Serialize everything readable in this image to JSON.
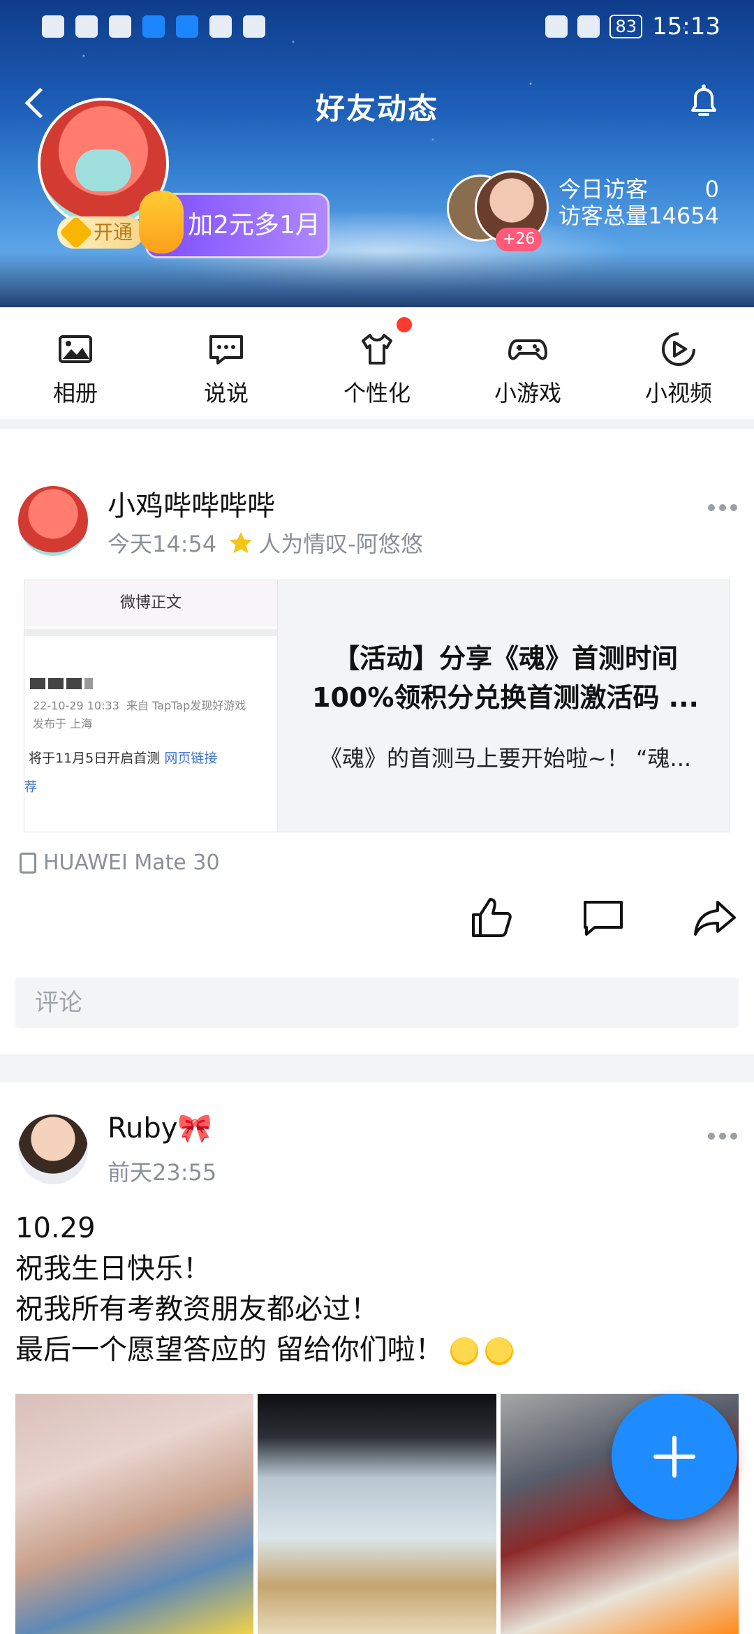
{
  "status_bar": {
    "left_icons": [
      "hd-icon",
      "signal-5g-icon",
      "wifi-icon",
      "shield-icon",
      "bulb-icon",
      "wechat-icon",
      "glove-icon"
    ],
    "battery": "83",
    "time": "15:13"
  },
  "header": {
    "title": "好友动态",
    "vip_label": "开通",
    "promo_text": "加2元多1月",
    "visitor_badge": "+26",
    "today_visitors_label": "今日访客",
    "today_visitors_value": "0",
    "total_visitors_label": "访客总量",
    "total_visitors_value": "14654"
  },
  "quick_nav": [
    {
      "label": "相册",
      "icon": "photo-icon"
    },
    {
      "label": "说说",
      "icon": "chat-icon"
    },
    {
      "label": "个性化",
      "icon": "tshirt-icon"
    },
    {
      "label": "小游戏",
      "icon": "gamepad-icon"
    },
    {
      "label": "小视频",
      "icon": "play-icon"
    }
  ],
  "post1": {
    "name": "小鸡哔哔哔哔",
    "time": "今天14:54",
    "music": "人为情叹-阿悠悠",
    "thumb_header": "微博正文",
    "thumb_date": "22-10-29 10:33",
    "thumb_from": "来自 TapTap发现好游戏",
    "thumb_loc": "发布于 上海",
    "thumb_kicker": "将于11月5日开启首测",
    "thumb_link": "网页链接",
    "thumb_rec": "荐",
    "share_title_line1": "【活动】分享《魂》首测时间",
    "share_title_line2": "100%领积分兑换首测激活码 ...",
    "share_desc": "《魂》的首测马上要开始啦~！ “魂...",
    "device": "HUAWEI Mate 30",
    "comment_placeholder": "评论"
  },
  "post2": {
    "name": "Ruby🎀",
    "time": "前天23:55",
    "text_line1": "10.29",
    "text_line2": "祝我生日快乐！",
    "text_line3": "祝我所有考教资朋友都必过！",
    "text_line4": "最后一个愿望答应的 留给你们啦！"
  }
}
